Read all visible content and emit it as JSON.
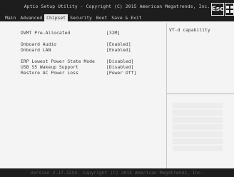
{
  "header": {
    "title": "Aptio Setup Utility - Copyright (C) 2015 American Megatrends, Inc.",
    "tabs": [
      {
        "label": "Main",
        "active": false
      },
      {
        "label": "Advanced",
        "active": false
      },
      {
        "label": "Chipset",
        "active": true
      },
      {
        "label": "Security",
        "active": false
      },
      {
        "label": "Boot",
        "active": false
      },
      {
        "label": "Save & Exit",
        "active": false
      }
    ],
    "esc_label": "Esc"
  },
  "settings": [
    {
      "label": "DVMT Pre-Allocated",
      "value": "[32M]"
    },
    {
      "label": "Onboard Audio",
      "value": "[Enabled]"
    },
    {
      "label": "Onboard LAN",
      "value": "[Enabled]"
    },
    {
      "label": "ERP Lowest Power State Mode",
      "value": "[Disabled]"
    },
    {
      "label": "USB S5 Wakeup Support",
      "value": "[Disabled]"
    },
    {
      "label": "Restore AC Power Loss",
      "value": "[Power Off]"
    }
  ],
  "help": {
    "text": "VT-d capability"
  },
  "footer": {
    "text": "Version 2.17.1254. Copyright (C) 2015 American Megatrends, Inc."
  },
  "colors": {
    "header_bg": "#1d1d1d",
    "active_tab_bg": "#eaeaea",
    "content_bg": "#f4f4f4",
    "text": "#3b3b3b"
  }
}
